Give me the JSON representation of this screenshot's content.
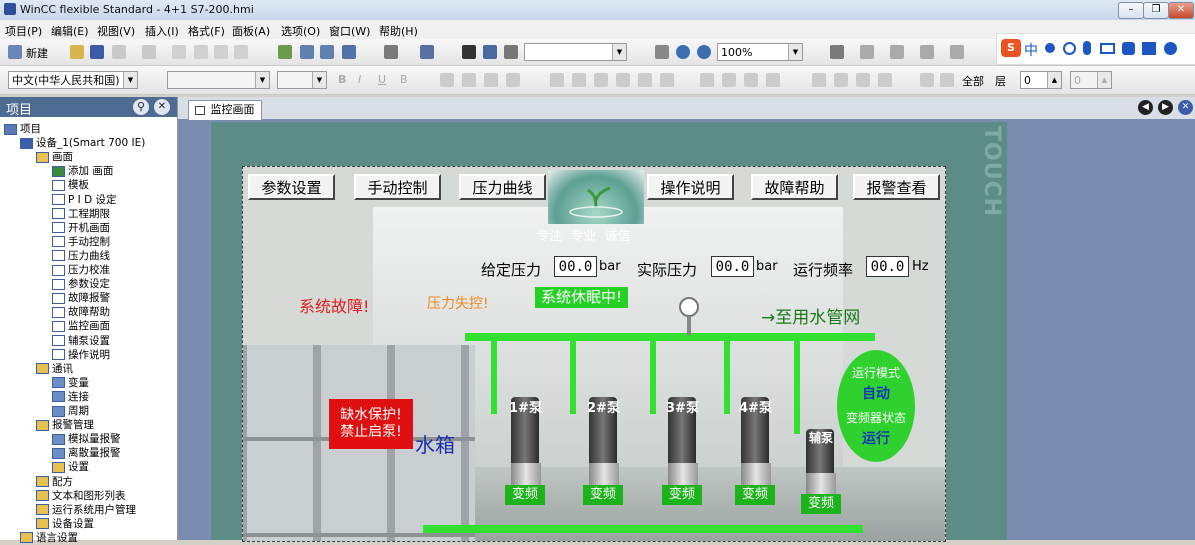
{
  "window": {
    "title": "WinCC flexible Standard - 4+1 S7-200.hmi"
  },
  "menubar": [
    "项目(P)",
    "编辑(E)",
    "视图(V)",
    "插入(I)",
    "格式(F)",
    "面板(A)",
    "选项(O)",
    "窗口(W)",
    "帮助(H)"
  ],
  "toolbar": {
    "new_label": "新建",
    "zoom": "100%",
    "language": "中文(中华人民共和国)",
    "all_label": "全部",
    "layer_label": "层",
    "layer_value": "0",
    "layer_value2": "0"
  },
  "ime": {
    "label": "中"
  },
  "project_panel": {
    "title": "项目",
    "tree": [
      {
        "label": "项目",
        "depth": 0,
        "icon": "project"
      },
      {
        "label": "设备_1(Smart 700 IE)",
        "depth": 1,
        "icon": "device"
      },
      {
        "label": "画面",
        "depth": 2,
        "icon": "folder"
      },
      {
        "label": "添加 画面",
        "depth": 3,
        "icon": "add"
      },
      {
        "label": "模板",
        "depth": 3,
        "icon": "screen"
      },
      {
        "label": "P I D 设定",
        "depth": 3,
        "icon": "screen"
      },
      {
        "label": "工程期限",
        "depth": 3,
        "icon": "screen"
      },
      {
        "label": "开机画面",
        "depth": 3,
        "icon": "screen"
      },
      {
        "label": "手动控制",
        "depth": 3,
        "icon": "screen"
      },
      {
        "label": "压力曲线",
        "depth": 3,
        "icon": "screen"
      },
      {
        "label": "压力校准",
        "depth": 3,
        "icon": "screen"
      },
      {
        "label": "参数设定",
        "depth": 3,
        "icon": "screen"
      },
      {
        "label": "故障报警",
        "depth": 3,
        "icon": "screen"
      },
      {
        "label": "故障帮助",
        "depth": 3,
        "icon": "screen"
      },
      {
        "label": "监控画面",
        "depth": 3,
        "icon": "screen"
      },
      {
        "label": "辅泵设置",
        "depth": 3,
        "icon": "screen"
      },
      {
        "label": "操作说明",
        "depth": 3,
        "icon": "screen"
      },
      {
        "label": "通讯",
        "depth": 2,
        "icon": "folder"
      },
      {
        "label": "变量",
        "depth": 3,
        "icon": "tag"
      },
      {
        "label": "连接",
        "depth": 3,
        "icon": "conn"
      },
      {
        "label": "周期",
        "depth": 3,
        "icon": "cycle"
      },
      {
        "label": "报警管理",
        "depth": 2,
        "icon": "folder"
      },
      {
        "label": "模拟量报警",
        "depth": 3,
        "icon": "alarm"
      },
      {
        "label": "离散量报警",
        "depth": 3,
        "icon": "alarm"
      },
      {
        "label": "设置",
        "depth": 3,
        "icon": "settings"
      },
      {
        "label": "配方",
        "depth": 2,
        "icon": "folder"
      },
      {
        "label": "文本和图形列表",
        "depth": 2,
        "icon": "folder"
      },
      {
        "label": "运行系统用户管理",
        "depth": 2,
        "icon": "folder"
      },
      {
        "label": "设备设置",
        "depth": 2,
        "icon": "folder"
      },
      {
        "label": "语言设置",
        "depth": 1,
        "icon": "folder"
      }
    ]
  },
  "editor": {
    "tab_label": "监控画面",
    "side_text": "TOUCH"
  },
  "hmi_screen": {
    "buttons": [
      "参数设置",
      "手动控制",
      "压力曲线",
      "操作说明",
      "故障帮助",
      "报警查看"
    ],
    "slogan": "专注  专业  诚信",
    "set_pressure_label": "给定压力",
    "set_pressure_value": "00.0",
    "set_pressure_unit": "bar",
    "actual_pressure_label": "实际压力",
    "actual_pressure_value": "00.0",
    "actual_pressure_unit": "bar",
    "run_freq_label": "运行频率",
    "run_freq_value": "00.0",
    "run_freq_unit": "Hz",
    "system_fault": "系统故障!",
    "pressure_loss": "压力失控!",
    "system_sleep": "系统休眠中!",
    "to_network": "→至用水管网",
    "water_shortage_line1": "缺水保护!",
    "water_shortage_line2": "禁止启泵!",
    "tank_label": "水箱",
    "pumps": [
      {
        "name": "1#泵",
        "mode": "变频"
      },
      {
        "name": "2#泵",
        "mode": "变频"
      },
      {
        "name": "3#泵",
        "mode": "变频"
      },
      {
        "name": "4#泵",
        "mode": "变频"
      },
      {
        "name": "辅泵",
        "mode": "变频"
      }
    ],
    "run_mode_label": "运行模式",
    "run_mode_value": "自动",
    "vfd_status_label": "变频器状态",
    "vfd_status_value": "运行"
  },
  "colors": {
    "accent_green": "#32e032",
    "fault_red": "#e02020",
    "panel_teal": "#5d8c87"
  }
}
